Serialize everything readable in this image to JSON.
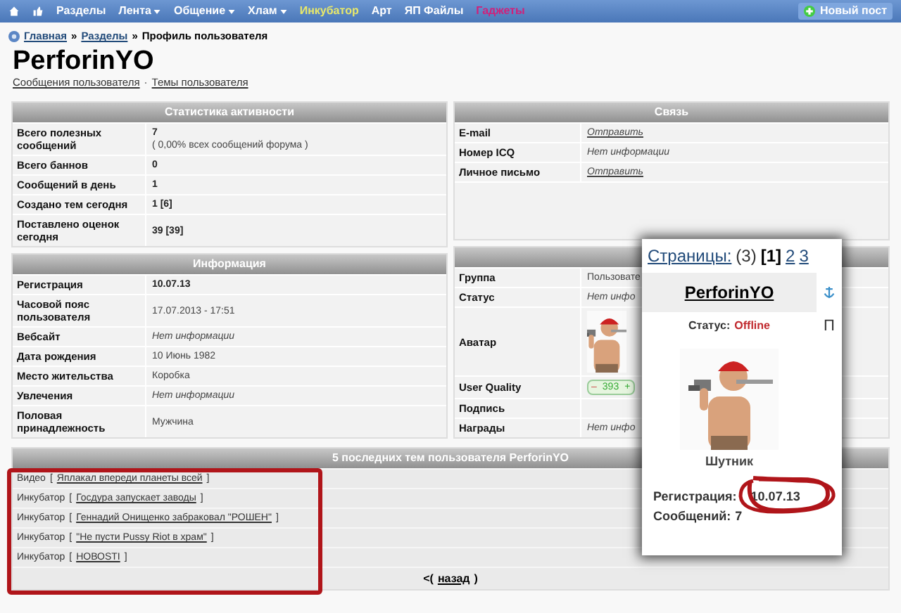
{
  "nav": {
    "items": [
      {
        "label": "Разделы",
        "color": "#ffffff",
        "dropdown": false
      },
      {
        "label": "Лента",
        "color": "#ffffff",
        "dropdown": true
      },
      {
        "label": "Общение",
        "color": "#ffffff",
        "dropdown": true
      },
      {
        "label": "Хлам",
        "color": "#ffffff",
        "dropdown": true
      },
      {
        "label": "Инкубатор",
        "color": "#e8e86a",
        "dropdown": false
      },
      {
        "label": "Арт",
        "color": "#ffffff",
        "dropdown": false
      },
      {
        "label": "ЯП Файлы",
        "color": "#ffffff",
        "dropdown": false
      },
      {
        "label": "Гаджеты",
        "color": "#d0207a",
        "dropdown": false
      }
    ],
    "new_post": "Новый пост"
  },
  "breadcrumb": {
    "items": [
      "Главная",
      "Разделы"
    ],
    "separator": "»",
    "current": "Профиль пользователя"
  },
  "profile": {
    "title": "PerforinYO",
    "links": [
      "Сообщения пользователя",
      "Темы пользователя"
    ],
    "link_separator": "·"
  },
  "stats": {
    "title": "Статистика активности",
    "rows": [
      {
        "label": "Всего полезных сообщений",
        "kind": "bold",
        "value": "7",
        "note": "( 0,00% всех сообщений форума )"
      },
      {
        "label": "Всего баннов",
        "kind": "bold",
        "value": "0"
      },
      {
        "label": "Сообщений в день",
        "kind": "bold",
        "value": "1"
      },
      {
        "label": "Создано тем сегодня",
        "kind": "bold",
        "value": "1 [6]"
      },
      {
        "label": "Поставлено оценок сегодня",
        "kind": "bold",
        "value": "39 [39]"
      }
    ]
  },
  "info": {
    "title": "Информация",
    "rows": [
      {
        "label": "Регистрация",
        "kind": "bold",
        "value": "10.07.13"
      },
      {
        "label": "Часовой пояс пользователя",
        "kind": "plain",
        "value": "17.07.2013 - 17:51"
      },
      {
        "label": "Вебсайт",
        "kind": "italic",
        "value": "Нет информации"
      },
      {
        "label": "Дата рождения",
        "kind": "plain",
        "value": "10 Июнь 1982"
      },
      {
        "label": "Место жительства",
        "kind": "plain",
        "value": "Коробка"
      },
      {
        "label": "Увлечения",
        "kind": "italic",
        "value": "Нет информации"
      },
      {
        "label": "Половая принадлежность",
        "kind": "plain",
        "value": "Мужчина"
      }
    ]
  },
  "contact": {
    "title": "Связь",
    "rows": [
      {
        "label": "E-mail",
        "kind": "link",
        "value": "Отправить"
      },
      {
        "label": "Номер ICQ",
        "kind": "italic",
        "value": "Нет информации"
      },
      {
        "label": "Личное письмо",
        "kind": "link",
        "value": "Отправить"
      }
    ]
  },
  "personal": {
    "rows": [
      {
        "label": "Группа",
        "kind": "plain",
        "value": "Пользовате"
      },
      {
        "label": "Статус",
        "kind": "italic",
        "value": "Нет инфо"
      },
      {
        "label": "Аватар",
        "kind": "picture"
      },
      {
        "label": "User Quality",
        "kind": "rating",
        "minus": "–",
        "value": "393",
        "plus": "+"
      },
      {
        "label": "Подпись",
        "kind": "empty"
      },
      {
        "label": "Награды",
        "kind": "italic",
        "value": "Нет инфо"
      }
    ]
  },
  "topics": {
    "title": "5 последних тем пользователя PerforinYO",
    "rows": [
      {
        "section": "Видео",
        "title": "Яплакал впереди планеты всей"
      },
      {
        "section": "Инкубатор",
        "title": "Госдура запускает заводы"
      },
      {
        "section": "Инкубатор",
        "title": "Геннадий Онищенко забраковал \"РОШЕН\""
      },
      {
        "section": "Инкубатор",
        "title": "\"Не пусти Pussy Riot в храм\""
      },
      {
        "section": "Инкубатор",
        "title": "НОВОSTI"
      }
    ],
    "open": "[",
    "close": "]",
    "back_open": "<(",
    "back": "назад",
    "back_close": ")"
  },
  "popup": {
    "pages_label": "Страницы:",
    "pages": [
      {
        "label": "(3)",
        "kind": "count"
      },
      {
        "label": "[1]",
        "kind": "current"
      },
      {
        "label": "2",
        "kind": "link"
      },
      {
        "label": "3",
        "kind": "link"
      }
    ],
    "username": "PerforinYO",
    "side_letter": "П",
    "status_label": "Статус:",
    "status": "Offline",
    "rank": "Шутник",
    "reg_label": "Регистрация:",
    "reg": "10.07.13",
    "msgs_label": "Сообщений:",
    "msgs": "7"
  }
}
